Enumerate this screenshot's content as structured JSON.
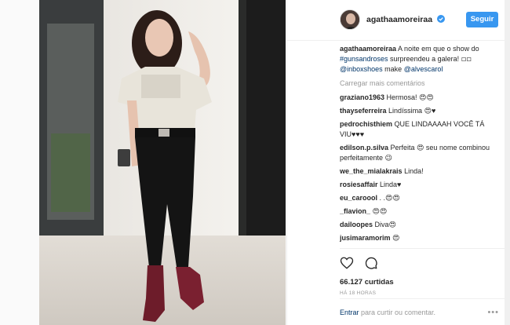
{
  "post": {
    "username": "agathaamoreiraa",
    "follow_label": "Seguir",
    "caption": {
      "user": "agathaamoreiraa",
      "text1": " A noite em que o show do ",
      "hashtag": "#gunsandroses",
      "text2": " surpreendeu a galera! ",
      "emoji": "◽◽",
      "mention1": "@inboxshoes",
      "text3": " make ",
      "mention2": "@alvescarol"
    },
    "load_more": "Carregar mais comentários",
    "comments": [
      {
        "user": "graziano1963",
        "text": " Hermosa! 😍😍"
      },
      {
        "user": "thayseferreira",
        "text": " Lindíssima 😍♥"
      },
      {
        "user": "pedrochisthiem",
        "text": " QUE LINDAAAAH VOCÊ TÁ VIU♥♥♥"
      },
      {
        "user": "edilson.p.silva",
        "text": " Perfeita 😍 seu nome combinou perfeitamente 😉"
      },
      {
        "user": "we_the_mialakrais",
        "text": " Linda!"
      },
      {
        "user": "rosiesaffair",
        "text": " Linda♥"
      },
      {
        "user": "eu_caroool",
        "text": " . .😍😍"
      },
      {
        "user": "_flavion_",
        "text": " 😍😍"
      },
      {
        "user": "dailoopes",
        "text": " Diva😍"
      },
      {
        "user": "jusimaramorim",
        "text": " 😍"
      }
    ],
    "likes": "66.127 curtidas",
    "time": "HÁ 18 HORAS",
    "login_link": "Entrar",
    "login_text": " para curtir ou comentar.",
    "more_dots": "•••"
  },
  "icons": {
    "like": "heart-icon",
    "comment": "comment-icon",
    "verified": "verified-badge-icon"
  },
  "colors": {
    "follow": "#3897f0",
    "link": "#003569",
    "muted": "#999999"
  }
}
